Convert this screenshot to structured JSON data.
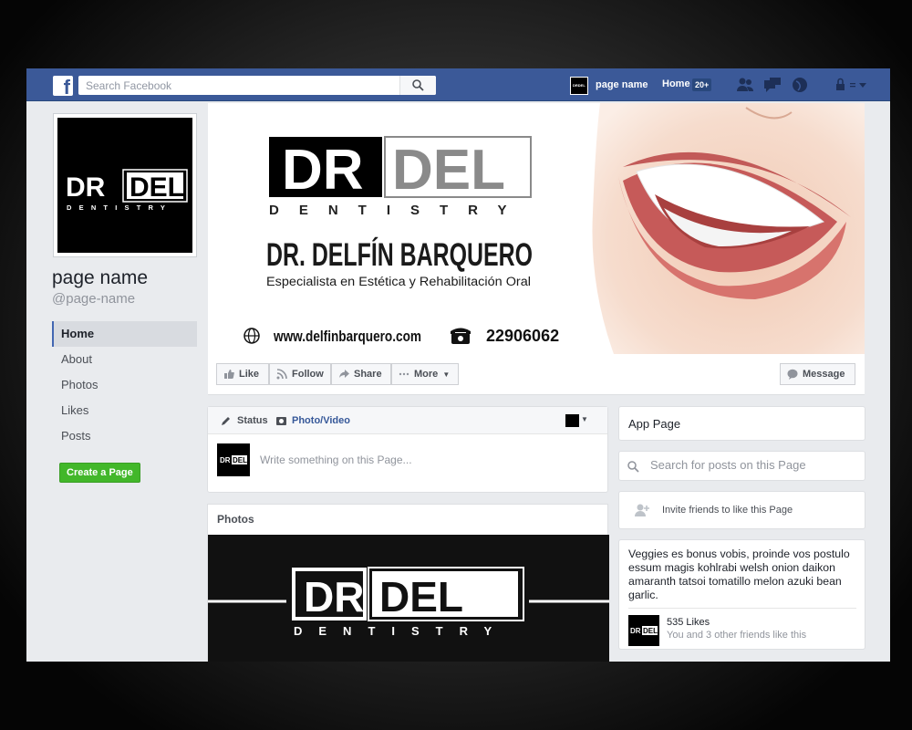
{
  "topbar": {
    "logo": "f",
    "search_placeholder": "Search Facebook",
    "page_name": "page name",
    "home_label": "Home",
    "home_badge": "20+",
    "icons": [
      "friends-icon",
      "messages-icon",
      "globe-icon",
      "privacy-icon",
      "dropdown-arrow-icon"
    ]
  },
  "profile": {
    "page_name": "page name",
    "handle": "@page-name",
    "logo_top": {
      "left": "DR",
      "right": "DEL"
    },
    "logo_bottom": "DENTISTRY"
  },
  "leftnav": {
    "items": [
      {
        "label": "Home",
        "active": true
      },
      {
        "label": "About"
      },
      {
        "label": "Photos"
      },
      {
        "label": "Likes"
      },
      {
        "label": "Posts"
      }
    ],
    "create_page": "Create a Page"
  },
  "cover": {
    "logo_left": "DR",
    "logo_right": "DEL",
    "logo_sub": "DENTISTRY",
    "doctor_name": "DR. DELFÍN BARQUERO",
    "specialty": "Especialista en Estética y Rehabilitación Oral",
    "website": "www.delfinbarquero.com",
    "phone": "22906062"
  },
  "actions": {
    "like": "Like",
    "follow": "Follow",
    "share": "Share",
    "more": "More",
    "message": "Message"
  },
  "composer": {
    "tab_status": "Status",
    "tab_photo": "Photo/Video",
    "placeholder": "Write something on this Page..."
  },
  "photos": {
    "title": "Photos",
    "logo_left": "DR",
    "logo_right": "DEL",
    "logo_sub": "DENTISTRY"
  },
  "sidebar": {
    "app_page": "App Page",
    "search_placeholder": "Search for posts on this Page",
    "invite": "Invite friends to like this Page",
    "about_text": "Veggies es bonus vobis, proinde vos postulo essum magis kohlrabi welsh onion daikon amaranth tatsoi tomatillo melon azuki bean garlic.",
    "likes_count": "535 Likes",
    "likes_friends": "You and 3 other friends like this"
  },
  "colors": {
    "facebook_blue": "#3b5998",
    "create_green": "#42b72a",
    "logo_gray": "#8a8a8a"
  }
}
